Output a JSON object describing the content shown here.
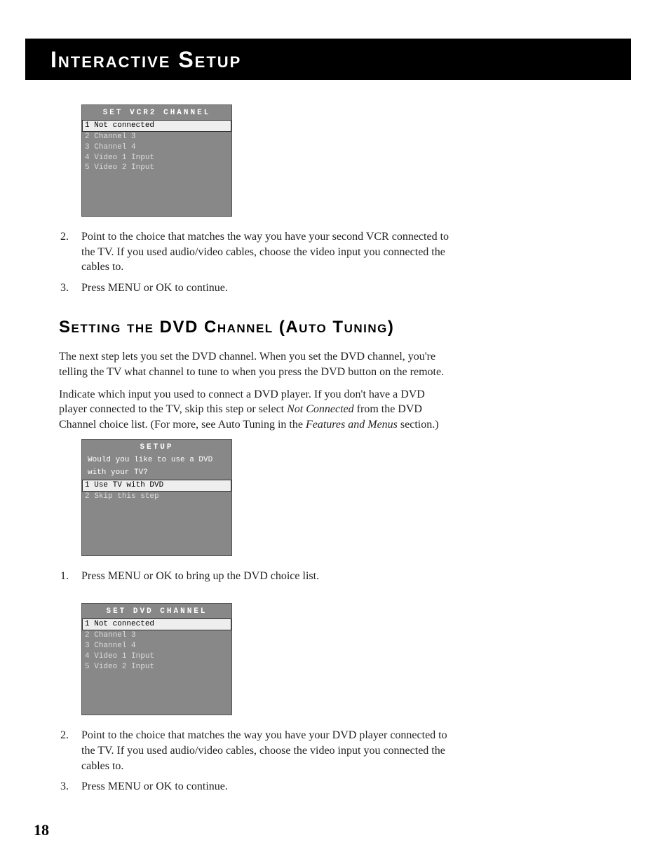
{
  "header": {
    "title": "Interactive Setup"
  },
  "osd1": {
    "title": "SET VCR2 CHANNEL",
    "items": [
      {
        "num": "1",
        "label": "Not connected",
        "selected": true
      },
      {
        "num": "2",
        "label": "Channel 3",
        "selected": false
      },
      {
        "num": "3",
        "label": "Channel 4",
        "selected": false
      },
      {
        "num": "4",
        "label": "Video 1 Input",
        "selected": false
      },
      {
        "num": "5",
        "label": "Video 2 Input",
        "selected": false
      }
    ]
  },
  "steps_a": [
    {
      "num": "2.",
      "text": "Point to the choice that matches the way you have your second VCR connected to the TV.  If you used audio/video cables, choose the video input you connected the cables to."
    },
    {
      "num": "3.",
      "text": "Press MENU or OK to continue."
    }
  ],
  "section_heading": "Setting the DVD Channel (Auto Tuning)",
  "para1": "The next step lets you set the DVD channel. When you set the DVD channel, you're telling the TV what channel to tune to when you press the DVD button on the remote.",
  "para2_a": "Indicate which input you used to connect a DVD player. If you don't have a DVD player connected to the TV, skip this step or select ",
  "para2_i1": "Not Connected",
  "para2_b": " from the DVD Channel choice list. (For more, see Auto Tuning in the ",
  "para2_i2": "Features and Menus",
  "para2_c": " section.)",
  "osd2": {
    "title": "SETUP",
    "prompt_l1": "Would you like to use a DVD",
    "prompt_l2": "with your TV?",
    "items": [
      {
        "num": "1",
        "label": "Use TV with DVD",
        "selected": true
      },
      {
        "num": "2",
        "label": "Skip this step",
        "selected": false
      }
    ]
  },
  "steps_b": [
    {
      "num": "1.",
      "text": "Press MENU or OK to bring up the DVD choice list."
    }
  ],
  "osd3": {
    "title": "SET DVD CHANNEL",
    "items": [
      {
        "num": "1",
        "label": "Not connected",
        "selected": true
      },
      {
        "num": "2",
        "label": "Channel 3",
        "selected": false
      },
      {
        "num": "3",
        "label": "Channel 4",
        "selected": false
      },
      {
        "num": "4",
        "label": "Video 1 Input",
        "selected": false
      },
      {
        "num": "5",
        "label": "Video 2 Input",
        "selected": false
      }
    ]
  },
  "steps_c": [
    {
      "num": "2.",
      "text": "Point to the choice that matches the way you have your DVD player connected to the TV. If you used audio/video cables, choose the video input you connected the cables to."
    },
    {
      "num": "3.",
      "text": "Press MENU or OK to continue."
    }
  ],
  "page_number": "18"
}
